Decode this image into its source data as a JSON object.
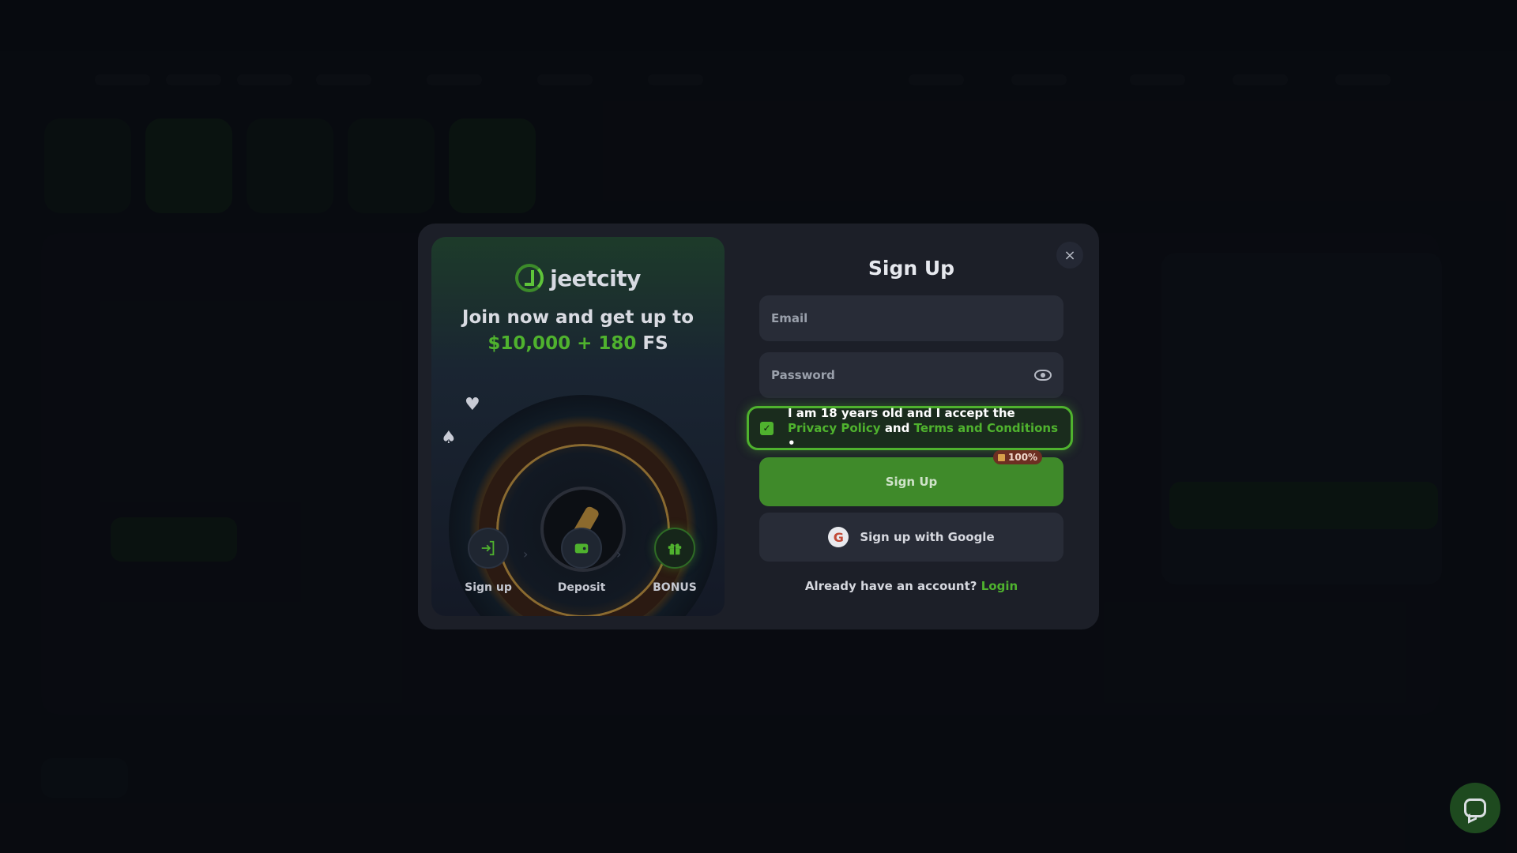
{
  "promo": {
    "brand": "jeetcity",
    "headline": "Join now and get up to",
    "amount": "$10,000 + 180",
    "fs": "FS",
    "steps": [
      {
        "label": "Sign up",
        "icon": "signin-icon"
      },
      {
        "label": "Deposit",
        "icon": "wallet-icon"
      },
      {
        "label": "BONUS",
        "icon": "gift-icon"
      }
    ]
  },
  "form": {
    "title": "Sign Up",
    "email_placeholder": "Email",
    "password_placeholder": "Password",
    "consent_prefix": "I am 18 years old and I accept the",
    "privacy_link": "Privacy Policy",
    "consent_and": "and",
    "terms_link": "Terms and Conditions",
    "required_mark": "•",
    "signup_button": "Sign Up",
    "bonus_badge": "100%",
    "google_button": "Sign up with Google",
    "account_prompt": "Already have an account?",
    "login_link": "Login",
    "close_symbol": "×"
  },
  "colors": {
    "accent_green": "#4fb22e",
    "modal_bg": "#1c1f28",
    "field_bg": "#282c37"
  }
}
